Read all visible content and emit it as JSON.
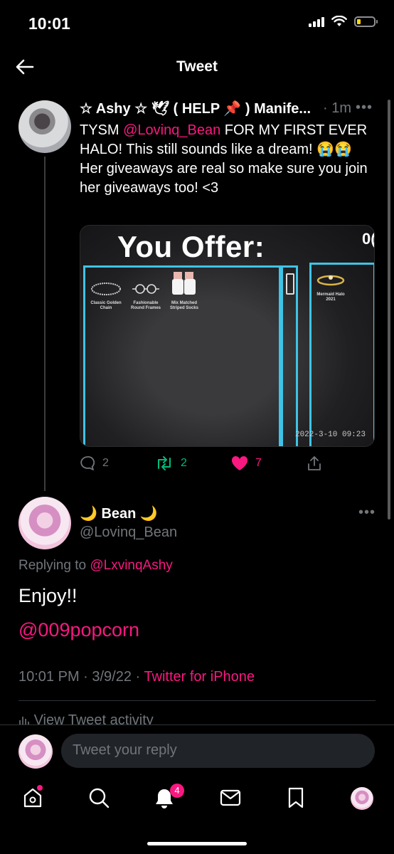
{
  "status": {
    "time": "10:01"
  },
  "header": {
    "title": "Tweet"
  },
  "tweet1": {
    "name": "☆ Ashy ☆ 🕊 ( HELP 📌 ) Manife...",
    "time": "· 1m",
    "more": "•••",
    "text_before": "TYSM ",
    "mention": "@Lovinq_Bean",
    "text_after": " FOR MY FIRST EVER HALO! This still sounds like a dream! 😭😭",
    "line2": "Her giveaways are real so make sure you join her giveaways too! <3",
    "media": {
      "title": "You Offer:",
      "corner": "0(",
      "items": [
        "Classic Golden Chain",
        "Fashionable Round Frames",
        "Mix Matched Striped Socks"
      ],
      "right_item": "Mermaid Halo 2021",
      "timestamp": "2022-3-10 09:23"
    },
    "actions": {
      "replies": "2",
      "retweets": "2",
      "likes": "7"
    }
  },
  "tweet2": {
    "name": "🌙 Bean 🌙",
    "handle": "@Lovinq_Bean",
    "more": "•••",
    "replying_prefix": "Replying to ",
    "replying_to": "@LxvinqAshy",
    "text": "Enjoy!!",
    "mention": "@009popcorn",
    "time": "10:01 PM · 3/9/22 · ",
    "source": "Twitter for iPhone",
    "activity": "View Tweet activity"
  },
  "reply": {
    "placeholder": "Tweet your reply"
  },
  "tabbar": {
    "notifications_badge": "4"
  },
  "colors": {
    "accent": "#f91880",
    "retweet": "#00ba7c",
    "muted": "#71767b",
    "cyan": "#3fc3e6"
  }
}
